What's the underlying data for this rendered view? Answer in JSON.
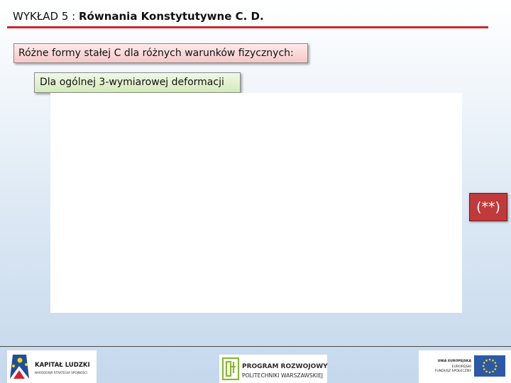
{
  "header": {
    "prefix": "WYKŁAD 5 : ",
    "title": "Równania Konstytutywne C. D."
  },
  "section_box": {
    "text": "Różne formy stałej C dla różnych warunków fizycznych:"
  },
  "subsection_box": {
    "text": "Dla ogólnej 3-wymiarowej deformacji"
  },
  "equation_marker": {
    "text": "(**)"
  },
  "footer": {
    "kapital_ludzki": {
      "line1": "KAPITAŁ LUDZKI",
      "line2": "NARODOWA STRATEGIA SPÓJNOŚCI"
    },
    "program": {
      "line1": "PROGRAM ROZWOJOWY",
      "line2": "POLITECHNIKI WARSZAWSKIEJ"
    },
    "ue": {
      "line1": "UNIA EUROPEJSKA",
      "line2": "EUROPEJSKI",
      "line3": "FUNDUSZ SPOŁECZNY"
    }
  },
  "colors": {
    "accent_red": "#d0242a",
    "section_fill": "#f6c8c8",
    "subsection_fill": "#d3eab8",
    "marker_fill": "#c0393b",
    "eu_blue": "#2b59a5",
    "eu_star": "#ffd800"
  }
}
